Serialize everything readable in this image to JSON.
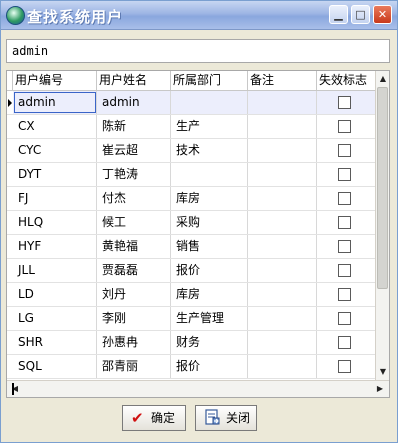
{
  "window": {
    "title": "查找系统用户"
  },
  "search": {
    "value": "admin"
  },
  "grid": {
    "columns": [
      "用户编号",
      "用户姓名",
      "所属部门",
      "备注",
      "失效标志"
    ],
    "rows": [
      {
        "code": "admin",
        "name": "admin",
        "dept": "",
        "note": "",
        "disabled": false
      },
      {
        "code": "CX",
        "name": "陈新",
        "dept": "生产",
        "note": "",
        "disabled": false
      },
      {
        "code": "CYC",
        "name": "崔云超",
        "dept": "技术",
        "note": "",
        "disabled": false
      },
      {
        "code": "DYT",
        "name": "丁艳涛",
        "dept": "",
        "note": "",
        "disabled": false
      },
      {
        "code": "FJ",
        "name": "付杰",
        "dept": "库房",
        "note": "",
        "disabled": false
      },
      {
        "code": "HLQ",
        "name": "候工",
        "dept": "采购",
        "note": "",
        "disabled": false
      },
      {
        "code": "HYF",
        "name": "黄艳福",
        "dept": "销售",
        "note": "",
        "disabled": false
      },
      {
        "code": "JLL",
        "name": "贾磊磊",
        "dept": "报价",
        "note": "",
        "disabled": false
      },
      {
        "code": "LD",
        "name": "刘丹",
        "dept": "库房",
        "note": "",
        "disabled": false
      },
      {
        "code": "LG",
        "name": "李刚",
        "dept": "生产管理",
        "note": "",
        "disabled": false
      },
      {
        "code": "SHR",
        "name": "孙惠冉",
        "dept": "财务",
        "note": "",
        "disabled": false
      },
      {
        "code": "SQL",
        "name": "邵青丽",
        "dept": "报价",
        "note": "",
        "disabled": false
      }
    ]
  },
  "buttons": {
    "ok": "确定",
    "close": "关闭"
  },
  "icons": {
    "ok": "checkmark-icon",
    "close": "close-document-icon"
  },
  "colors": {
    "selected_row": "#eceefc",
    "title_bar": "#9db5e4"
  }
}
